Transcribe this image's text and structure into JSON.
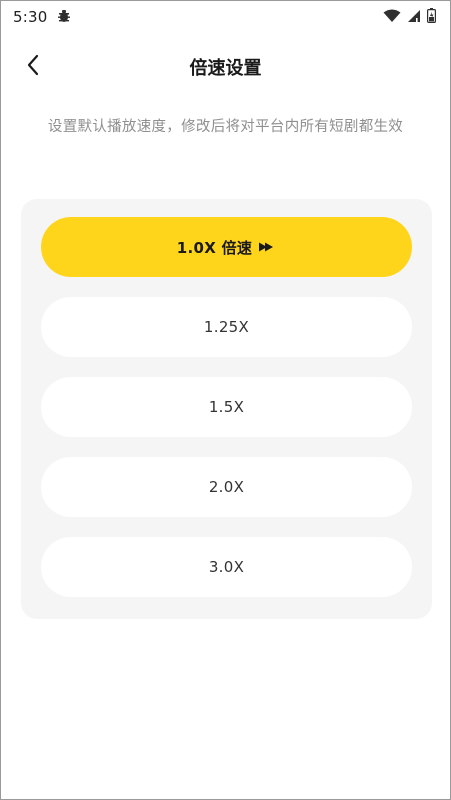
{
  "status_bar": {
    "time": "5:30",
    "icons": [
      "bug-icon",
      "wifi-icon",
      "signal-icon",
      "battery-icon"
    ]
  },
  "header": {
    "back_icon": "chevron-left-icon",
    "title": "倍速设置"
  },
  "description": "设置默认播放速度，修改后将对平台内所有短剧都生效",
  "options": [
    {
      "label": "1.0X 倍速",
      "selected": true
    },
    {
      "label": "1.25X",
      "selected": false
    },
    {
      "label": "1.5X",
      "selected": false
    },
    {
      "label": "2.0X",
      "selected": false
    },
    {
      "label": "3.0X",
      "selected": false
    }
  ],
  "colors": {
    "accent": "#ffd51c",
    "panel_bg": "#f5f5f5",
    "desc_text": "#8f8f8f"
  }
}
